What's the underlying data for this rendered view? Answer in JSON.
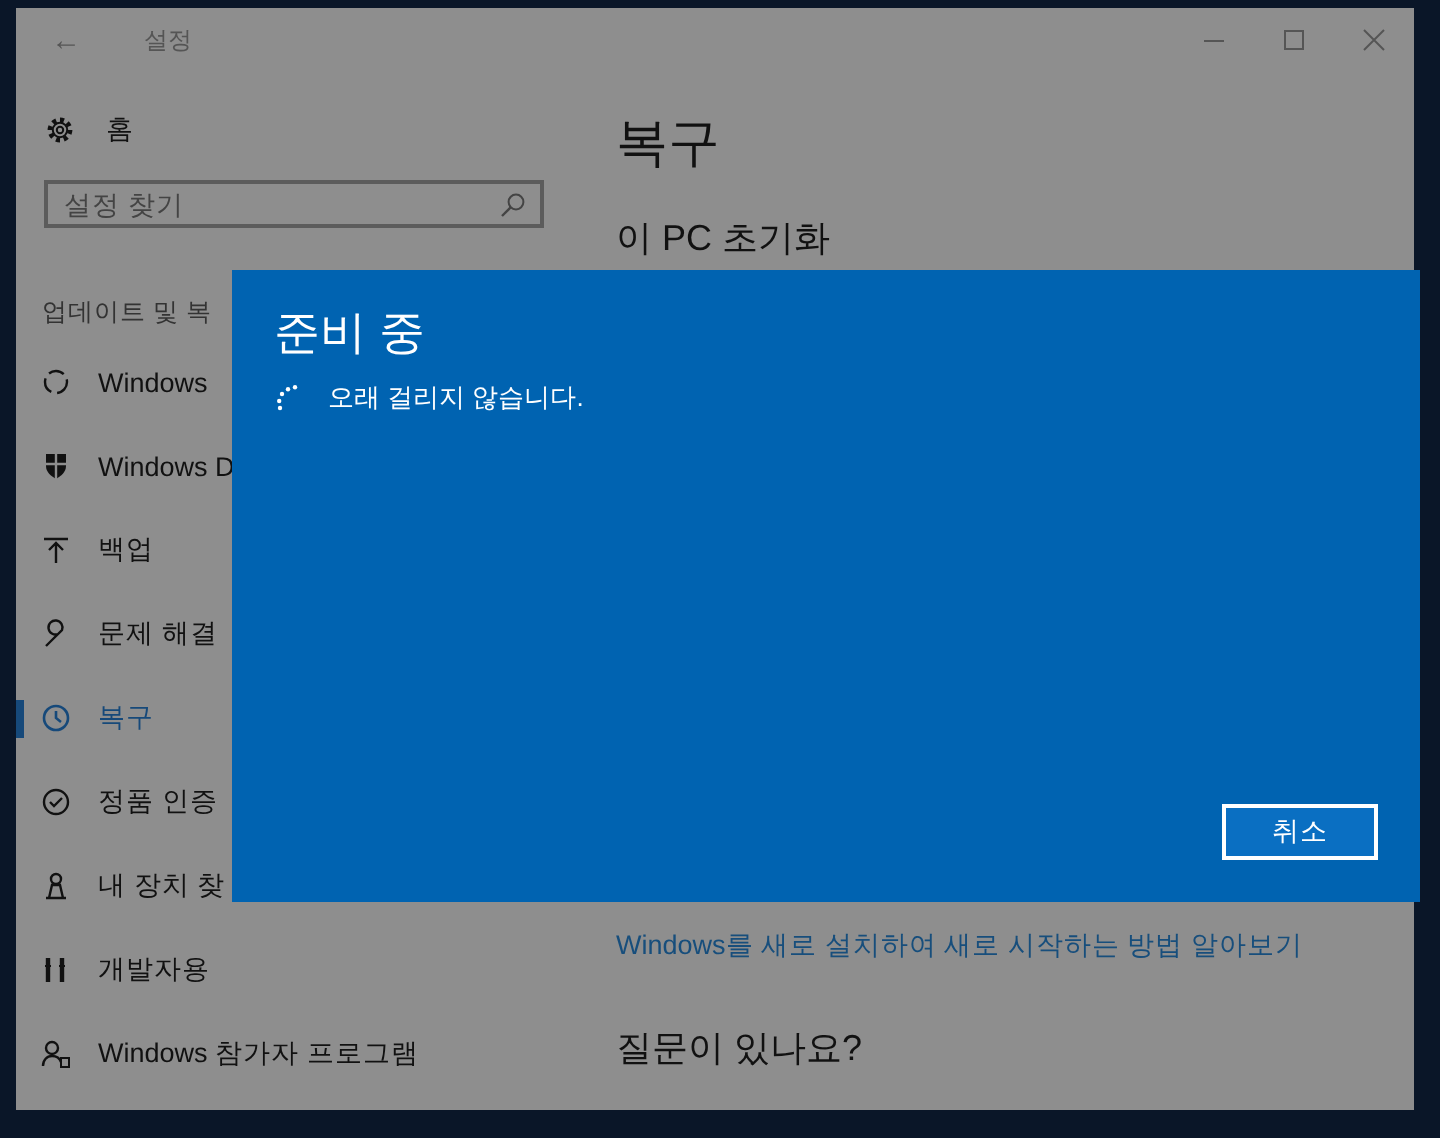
{
  "window": {
    "title": "설정",
    "back": "←"
  },
  "sidebar": {
    "home": "홈",
    "search": {
      "placeholder": "설정 찾기"
    },
    "section": "업데이트 및 복",
    "items": [
      {
        "label": "Windows",
        "selected": false
      },
      {
        "label": "Windows D",
        "selected": false
      },
      {
        "label": "백업",
        "selected": false
      },
      {
        "label": "문제 해결",
        "selected": false
      },
      {
        "label": "복구",
        "selected": true
      },
      {
        "label": "정품 인증",
        "selected": false
      },
      {
        "label": "내 장치 찾",
        "selected": false
      },
      {
        "label": "개발자용",
        "selected": false
      },
      {
        "label": "Windows 참가자 프로그램",
        "selected": false
      }
    ]
  },
  "content": {
    "title": "복구",
    "section": "이 PC 초기화",
    "link": "Windows를 새로 설치하여 새로 시작하는 방법 알아보기",
    "question": "질문이 있나요?"
  },
  "dialog": {
    "title": "준비 중",
    "message": "오래 걸리지 않습니다.",
    "button": "취소"
  }
}
